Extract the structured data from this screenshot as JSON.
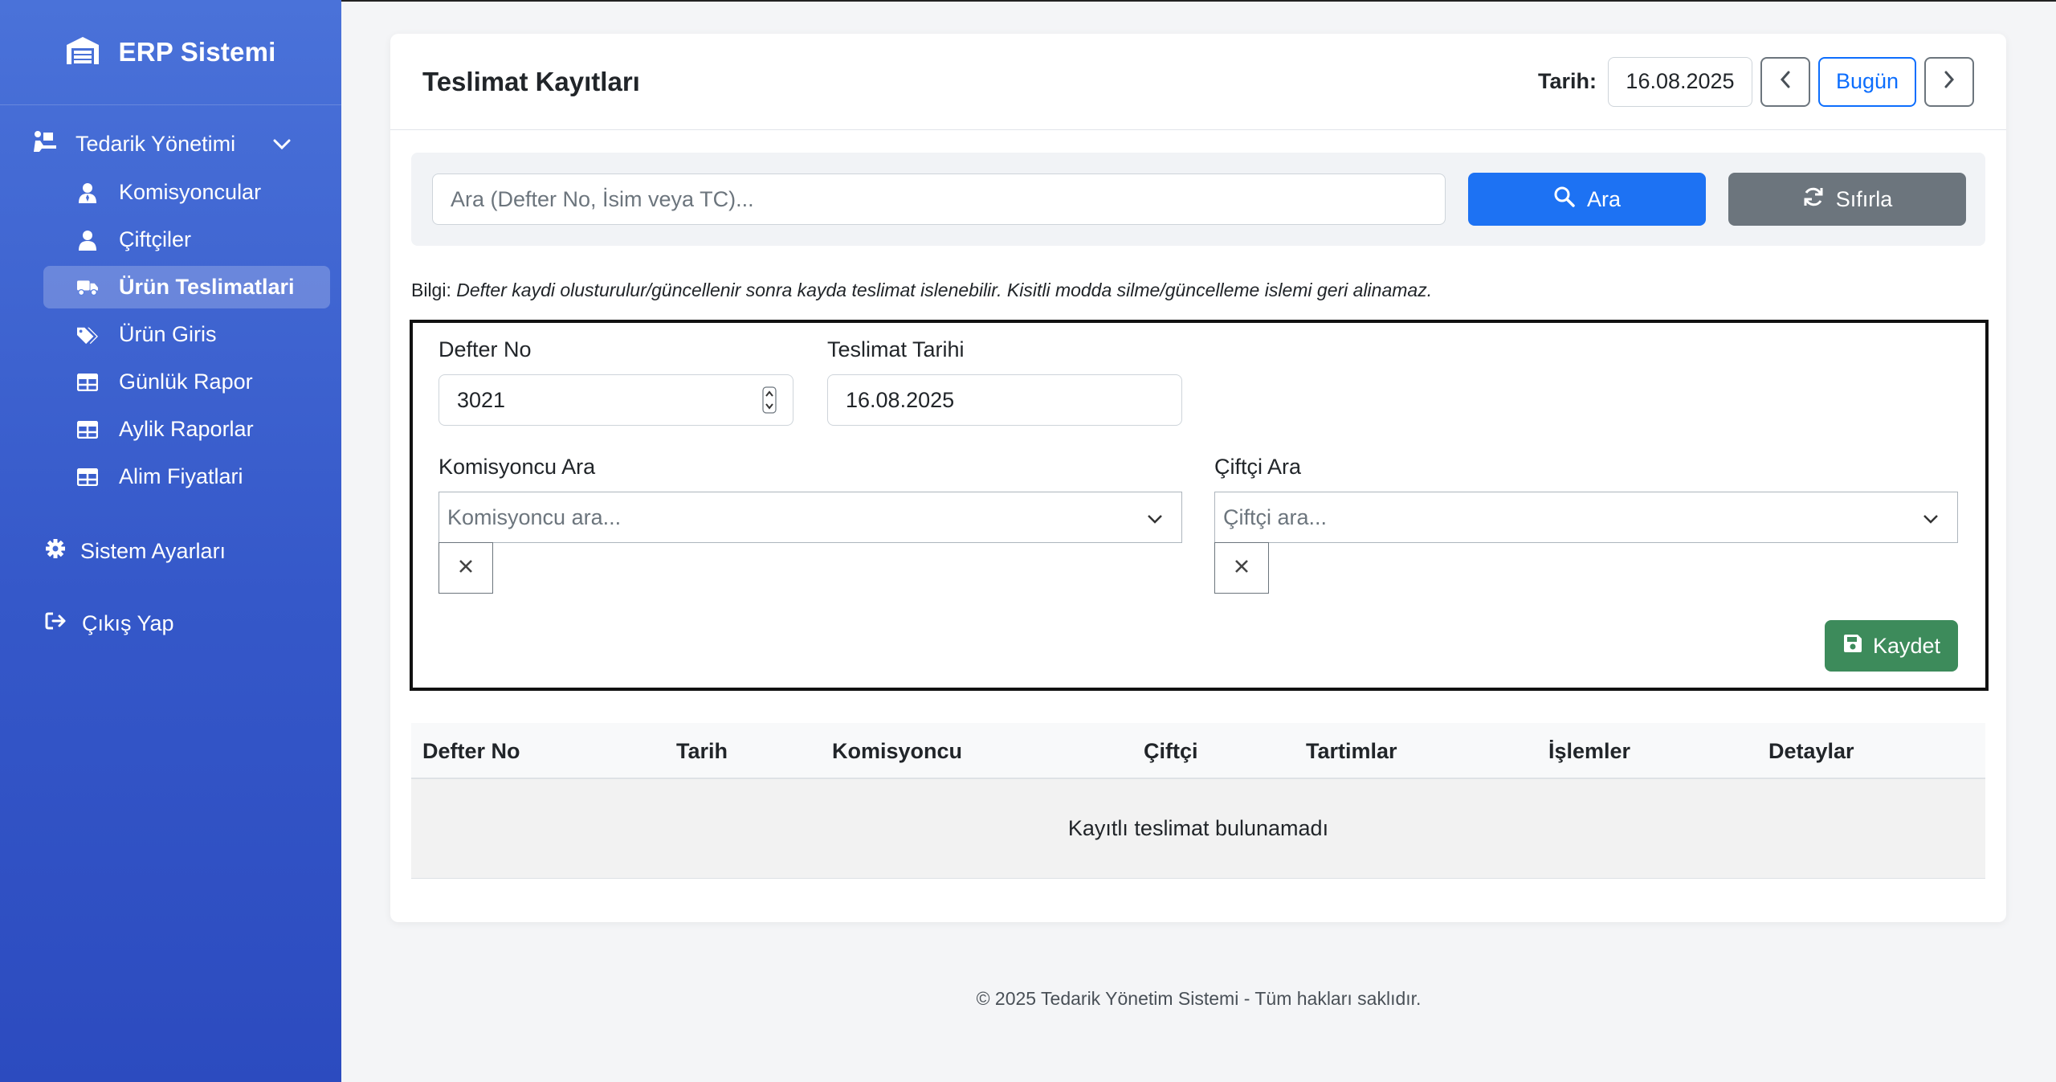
{
  "sidebar": {
    "brand": "ERP Sistemi",
    "group": {
      "label": "Tedarik Yönetimi"
    },
    "items": [
      {
        "label": "Komisyoncular",
        "icon": "user-tie-icon"
      },
      {
        "label": "Çiftçiler",
        "icon": "user-icon"
      },
      {
        "label": "Ürün Teslimatlari",
        "icon": "truck-icon",
        "active": true
      },
      {
        "label": "Ürün Giris",
        "icon": "tags-icon"
      },
      {
        "label": "Günlük Rapor",
        "icon": "table-icon"
      },
      {
        "label": "Aylik Raporlar",
        "icon": "table-icon"
      },
      {
        "label": "Alim Fiyatlari",
        "icon": "table-icon"
      }
    ],
    "settings": "Sistem Ayarları",
    "logout": "Çıkış Yap"
  },
  "header": {
    "title": "Teslimat Kayıtları",
    "date_label": "Tarih:",
    "date_value": "16.08.2025",
    "today_button": "Bugün"
  },
  "search": {
    "placeholder": "Ara (Defter No, İsim veya TC)...",
    "search_button": "Ara",
    "reset_button": "Sıfırla"
  },
  "info": {
    "prefix": "Bilgi:",
    "text": "Defter kaydi olusturulur/güncellenir sonra kayda teslimat islenebilir. Kisitli modda silme/güncelleme islemi geri alinamaz."
  },
  "form": {
    "defter_label": "Defter No",
    "defter_value": "3021",
    "tarih_label": "Teslimat Tarihi",
    "tarih_value": "16.08.2025",
    "komisyoncu_label": "Komisyoncu Ara",
    "komisyoncu_placeholder": "Komisyoncu ara...",
    "ciftci_label": "Çiftçi Ara",
    "ciftci_placeholder": "Çiftçi ara...",
    "save_button": "Kaydet"
  },
  "table": {
    "columns": [
      "Defter No",
      "Tarih",
      "Komisyoncu",
      "Çiftçi",
      "Tartimlar",
      "İşlemler",
      "Detaylar"
    ],
    "empty_message": "Kayıtlı teslimat bulunamadı"
  },
  "footer": "© 2025 Tedarik Yönetim Sistemi - Tüm hakları saklıdır.",
  "colors": {
    "sidebar_top": "#4a72d9",
    "sidebar_bottom": "#2c4bbf",
    "primary": "#1d72f3",
    "secondary": "#6c757d",
    "success": "#3d8b5b"
  }
}
